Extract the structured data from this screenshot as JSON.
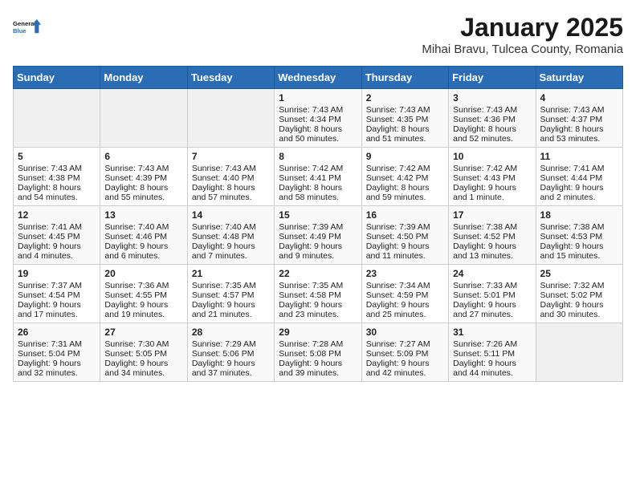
{
  "logo": {
    "line1": "General",
    "line2": "Blue"
  },
  "title": "January 2025",
  "location": "Mihai Bravu, Tulcea County, Romania",
  "weekdays": [
    "Sunday",
    "Monday",
    "Tuesday",
    "Wednesday",
    "Thursday",
    "Friday",
    "Saturday"
  ],
  "weeks": [
    [
      {
        "day": "",
        "sunrise": "",
        "sunset": "",
        "daylight": ""
      },
      {
        "day": "",
        "sunrise": "",
        "sunset": "",
        "daylight": ""
      },
      {
        "day": "",
        "sunrise": "",
        "sunset": "",
        "daylight": ""
      },
      {
        "day": "1",
        "sunrise": "Sunrise: 7:43 AM",
        "sunset": "Sunset: 4:34 PM",
        "daylight": "Daylight: 8 hours and 50 minutes."
      },
      {
        "day": "2",
        "sunrise": "Sunrise: 7:43 AM",
        "sunset": "Sunset: 4:35 PM",
        "daylight": "Daylight: 8 hours and 51 minutes."
      },
      {
        "day": "3",
        "sunrise": "Sunrise: 7:43 AM",
        "sunset": "Sunset: 4:36 PM",
        "daylight": "Daylight: 8 hours and 52 minutes."
      },
      {
        "day": "4",
        "sunrise": "Sunrise: 7:43 AM",
        "sunset": "Sunset: 4:37 PM",
        "daylight": "Daylight: 8 hours and 53 minutes."
      }
    ],
    [
      {
        "day": "5",
        "sunrise": "Sunrise: 7:43 AM",
        "sunset": "Sunset: 4:38 PM",
        "daylight": "Daylight: 8 hours and 54 minutes."
      },
      {
        "day": "6",
        "sunrise": "Sunrise: 7:43 AM",
        "sunset": "Sunset: 4:39 PM",
        "daylight": "Daylight: 8 hours and 55 minutes."
      },
      {
        "day": "7",
        "sunrise": "Sunrise: 7:43 AM",
        "sunset": "Sunset: 4:40 PM",
        "daylight": "Daylight: 8 hours and 57 minutes."
      },
      {
        "day": "8",
        "sunrise": "Sunrise: 7:42 AM",
        "sunset": "Sunset: 4:41 PM",
        "daylight": "Daylight: 8 hours and 58 minutes."
      },
      {
        "day": "9",
        "sunrise": "Sunrise: 7:42 AM",
        "sunset": "Sunset: 4:42 PM",
        "daylight": "Daylight: 8 hours and 59 minutes."
      },
      {
        "day": "10",
        "sunrise": "Sunrise: 7:42 AM",
        "sunset": "Sunset: 4:43 PM",
        "daylight": "Daylight: 9 hours and 1 minute."
      },
      {
        "day": "11",
        "sunrise": "Sunrise: 7:41 AM",
        "sunset": "Sunset: 4:44 PM",
        "daylight": "Daylight: 9 hours and 2 minutes."
      }
    ],
    [
      {
        "day": "12",
        "sunrise": "Sunrise: 7:41 AM",
        "sunset": "Sunset: 4:45 PM",
        "daylight": "Daylight: 9 hours and 4 minutes."
      },
      {
        "day": "13",
        "sunrise": "Sunrise: 7:40 AM",
        "sunset": "Sunset: 4:46 PM",
        "daylight": "Daylight: 9 hours and 6 minutes."
      },
      {
        "day": "14",
        "sunrise": "Sunrise: 7:40 AM",
        "sunset": "Sunset: 4:48 PM",
        "daylight": "Daylight: 9 hours and 7 minutes."
      },
      {
        "day": "15",
        "sunrise": "Sunrise: 7:39 AM",
        "sunset": "Sunset: 4:49 PM",
        "daylight": "Daylight: 9 hours and 9 minutes."
      },
      {
        "day": "16",
        "sunrise": "Sunrise: 7:39 AM",
        "sunset": "Sunset: 4:50 PM",
        "daylight": "Daylight: 9 hours and 11 minutes."
      },
      {
        "day": "17",
        "sunrise": "Sunrise: 7:38 AM",
        "sunset": "Sunset: 4:52 PM",
        "daylight": "Daylight: 9 hours and 13 minutes."
      },
      {
        "day": "18",
        "sunrise": "Sunrise: 7:38 AM",
        "sunset": "Sunset: 4:53 PM",
        "daylight": "Daylight: 9 hours and 15 minutes."
      }
    ],
    [
      {
        "day": "19",
        "sunrise": "Sunrise: 7:37 AM",
        "sunset": "Sunset: 4:54 PM",
        "daylight": "Daylight: 9 hours and 17 minutes."
      },
      {
        "day": "20",
        "sunrise": "Sunrise: 7:36 AM",
        "sunset": "Sunset: 4:55 PM",
        "daylight": "Daylight: 9 hours and 19 minutes."
      },
      {
        "day": "21",
        "sunrise": "Sunrise: 7:35 AM",
        "sunset": "Sunset: 4:57 PM",
        "daylight": "Daylight: 9 hours and 21 minutes."
      },
      {
        "day": "22",
        "sunrise": "Sunrise: 7:35 AM",
        "sunset": "Sunset: 4:58 PM",
        "daylight": "Daylight: 9 hours and 23 minutes."
      },
      {
        "day": "23",
        "sunrise": "Sunrise: 7:34 AM",
        "sunset": "Sunset: 4:59 PM",
        "daylight": "Daylight: 9 hours and 25 minutes."
      },
      {
        "day": "24",
        "sunrise": "Sunrise: 7:33 AM",
        "sunset": "Sunset: 5:01 PM",
        "daylight": "Daylight: 9 hours and 27 minutes."
      },
      {
        "day": "25",
        "sunrise": "Sunrise: 7:32 AM",
        "sunset": "Sunset: 5:02 PM",
        "daylight": "Daylight: 9 hours and 30 minutes."
      }
    ],
    [
      {
        "day": "26",
        "sunrise": "Sunrise: 7:31 AM",
        "sunset": "Sunset: 5:04 PM",
        "daylight": "Daylight: 9 hours and 32 minutes."
      },
      {
        "day": "27",
        "sunrise": "Sunrise: 7:30 AM",
        "sunset": "Sunset: 5:05 PM",
        "daylight": "Daylight: 9 hours and 34 minutes."
      },
      {
        "day": "28",
        "sunrise": "Sunrise: 7:29 AM",
        "sunset": "Sunset: 5:06 PM",
        "daylight": "Daylight: 9 hours and 37 minutes."
      },
      {
        "day": "29",
        "sunrise": "Sunrise: 7:28 AM",
        "sunset": "Sunset: 5:08 PM",
        "daylight": "Daylight: 9 hours and 39 minutes."
      },
      {
        "day": "30",
        "sunrise": "Sunrise: 7:27 AM",
        "sunset": "Sunset: 5:09 PM",
        "daylight": "Daylight: 9 hours and 42 minutes."
      },
      {
        "day": "31",
        "sunrise": "Sunrise: 7:26 AM",
        "sunset": "Sunset: 5:11 PM",
        "daylight": "Daylight: 9 hours and 44 minutes."
      },
      {
        "day": "",
        "sunrise": "",
        "sunset": "",
        "daylight": ""
      }
    ]
  ]
}
